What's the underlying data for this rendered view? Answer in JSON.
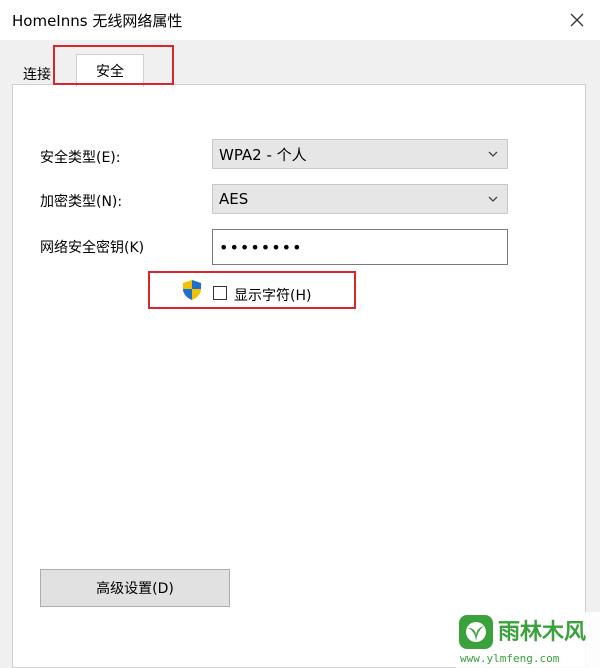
{
  "window": {
    "title": "HomeInns 无线网络属性"
  },
  "tabs": [
    {
      "label": "连接",
      "active": false
    },
    {
      "label": "安全",
      "active": true
    }
  ],
  "form": {
    "security_type_label": "安全类型(E):",
    "security_type_value": "WPA2 - 个人",
    "encryption_type_label": "加密类型(N):",
    "encryption_type_value": "AES",
    "key_label": "网络安全密钥(K)",
    "key_value": "••••••••",
    "show_chars_label": "显示字符(H)",
    "show_chars_checked": false
  },
  "advanced_button": {
    "label": "高级设置(D)"
  },
  "icons": {
    "close": "close-icon",
    "chevron": "chevron-down-icon",
    "shield": "uac-shield-icon"
  },
  "colors": {
    "highlight": "#d8262c",
    "watermark": "#3aa13d"
  },
  "watermark": {
    "title": "雨林木风",
    "url": "www.ylmfeng.com"
  }
}
